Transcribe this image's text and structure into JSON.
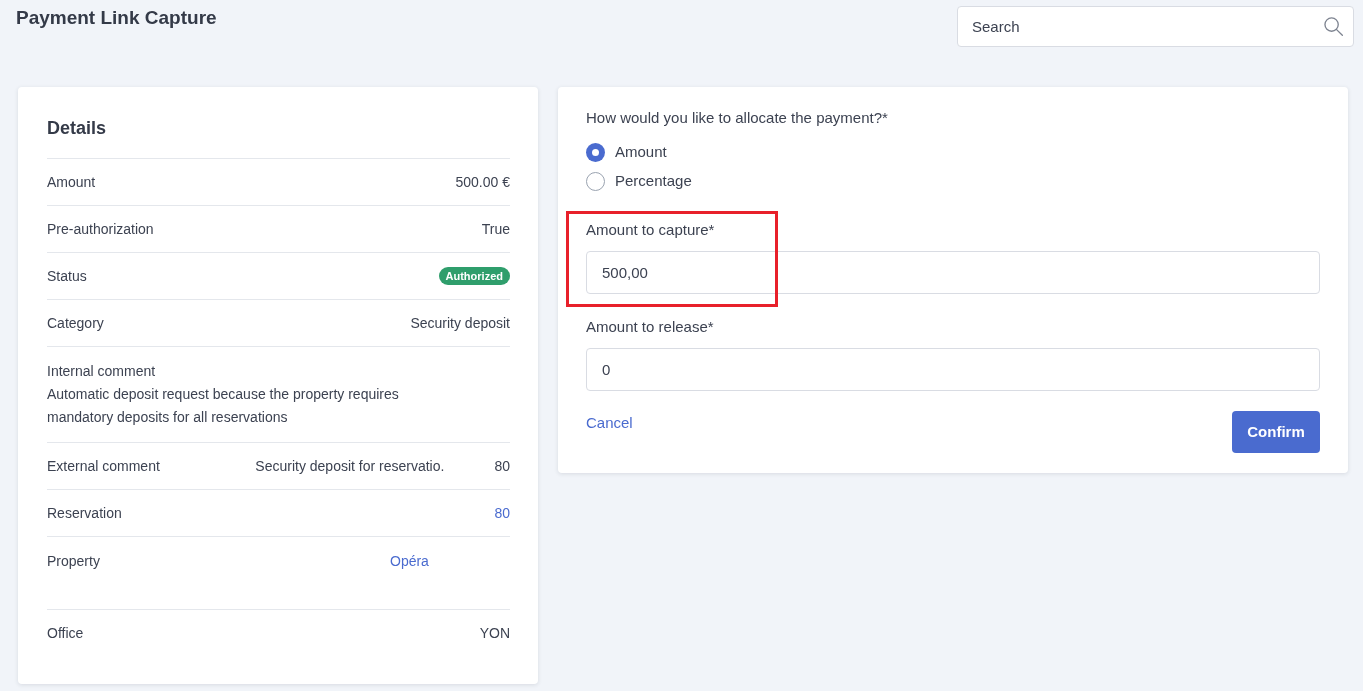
{
  "page": {
    "title": "Payment Link Capture"
  },
  "search": {
    "placeholder": "Search"
  },
  "details": {
    "title": "Details",
    "rows": [
      {
        "kind": "text",
        "label": "Amount",
        "value": "500.00 €"
      },
      {
        "kind": "text",
        "label": "Pre-authorization",
        "value": "True"
      },
      {
        "kind": "badge",
        "label": "Status",
        "value": "Authorized"
      },
      {
        "kind": "text",
        "label": "Category",
        "value": "Security deposit"
      },
      {
        "kind": "note",
        "label": "Internal comment",
        "value": "Automatic deposit request because the property requires mandatory deposits for all reservations"
      },
      {
        "kind": "split",
        "label": "External comment",
        "parts": [
          "Security deposit for reservatio.",
          "80"
        ]
      },
      {
        "kind": "link",
        "label": "Reservation",
        "value": "80"
      },
      {
        "kind": "block_link",
        "label": "Property",
        "value": "Opéra"
      },
      {
        "kind": "text",
        "label": "Office",
        "value": "YON"
      }
    ]
  },
  "allocation": {
    "question": "How would you like to allocate the payment?*",
    "options": [
      {
        "label": "Amount",
        "selected": true
      },
      {
        "label": "Percentage",
        "selected": false
      }
    ]
  },
  "fields": [
    {
      "label": "Amount to capture*",
      "value": "500,00",
      "highlighted": true
    },
    {
      "label": "Amount to release*",
      "value": "0",
      "highlighted": false
    }
  ],
  "actions": {
    "cancel": "Cancel",
    "confirm": "Confirm"
  }
}
